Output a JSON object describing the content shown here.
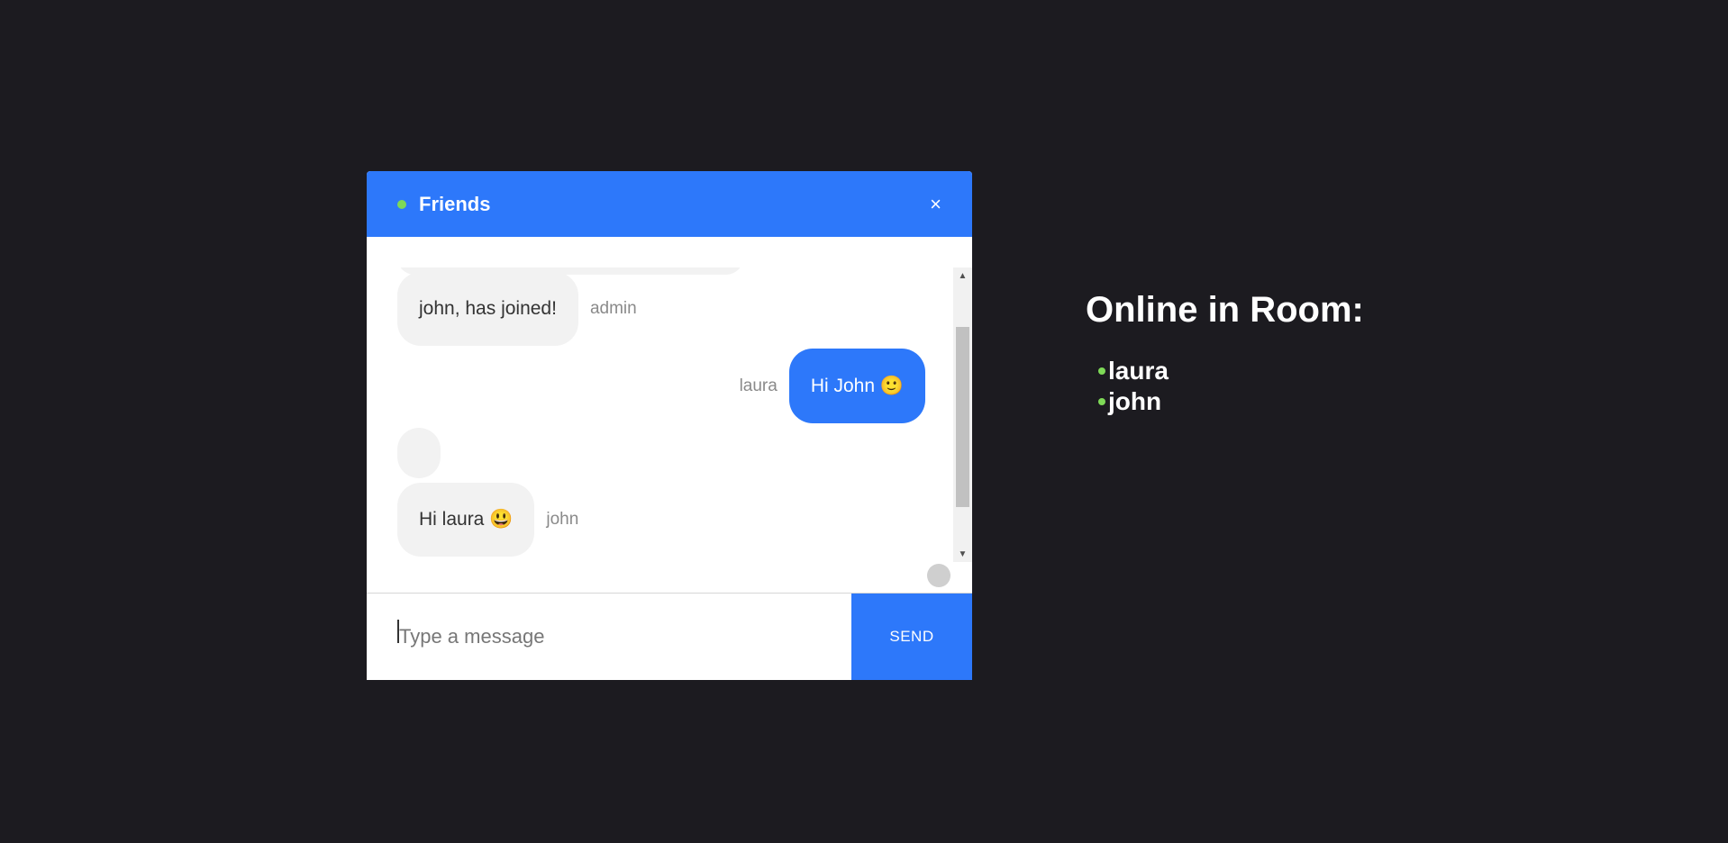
{
  "chat": {
    "room_name": "Friends",
    "close_icon": "×",
    "messages": [
      {
        "text": "john, has joined!",
        "sender": "admin",
        "direction": "incoming"
      },
      {
        "text": "Hi John 🙂",
        "sender": "laura",
        "direction": "outgoing"
      },
      {
        "text": "",
        "sender": "",
        "direction": "incoming"
      },
      {
        "text": "Hi laura 😃",
        "sender": "john",
        "direction": "incoming"
      }
    ],
    "input_placeholder": "Type a message",
    "send_label": "SEND"
  },
  "online": {
    "title": "Online in Room:",
    "users": [
      "laura",
      "john"
    ]
  },
  "colors": {
    "accent": "#2d78fa",
    "online_dot": "#7ed957",
    "background": "#1c1b20"
  }
}
